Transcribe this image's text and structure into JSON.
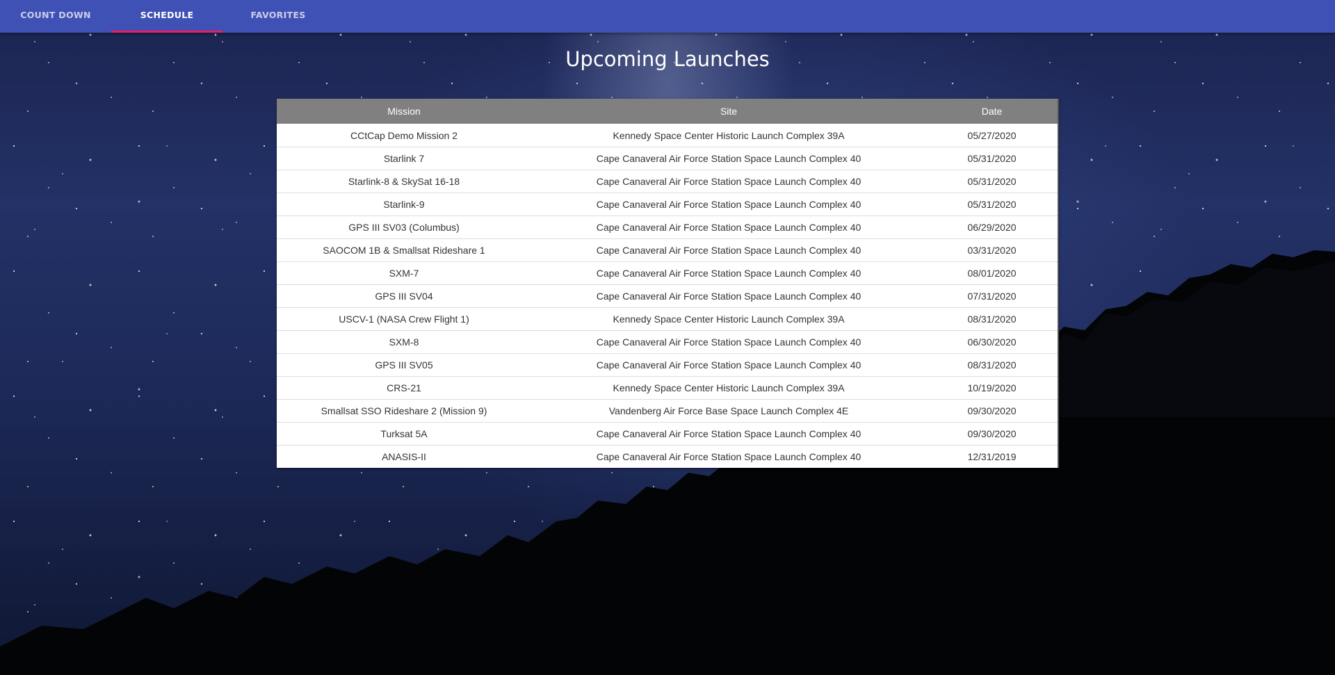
{
  "nav": {
    "tabs": [
      {
        "label": "COUNT DOWN",
        "active": false
      },
      {
        "label": "SCHEDULE",
        "active": true
      },
      {
        "label": "FAVORITES",
        "active": false
      }
    ],
    "bar_color": "#3f51b5",
    "indicator_color": "#e91e63"
  },
  "page": {
    "title": "Upcoming Launches"
  },
  "table": {
    "header_color": "#808080",
    "columns": [
      "Mission",
      "Site",
      "Date"
    ],
    "rows": [
      {
        "mission": "CCtCap Demo Mission 2",
        "site": "Kennedy Space Center Historic Launch Complex 39A",
        "date": "05/27/2020"
      },
      {
        "mission": "Starlink 7",
        "site": "Cape Canaveral Air Force Station Space Launch Complex 40",
        "date": "05/31/2020"
      },
      {
        "mission": "Starlink-8 & SkySat 16-18",
        "site": "Cape Canaveral Air Force Station Space Launch Complex 40",
        "date": "05/31/2020"
      },
      {
        "mission": "Starlink-9",
        "site": "Cape Canaveral Air Force Station Space Launch Complex 40",
        "date": "05/31/2020"
      },
      {
        "mission": "GPS III SV03 (Columbus)",
        "site": "Cape Canaveral Air Force Station Space Launch Complex 40",
        "date": "06/29/2020"
      },
      {
        "mission": "SAOCOM 1B & Smallsat Rideshare 1",
        "site": "Cape Canaveral Air Force Station Space Launch Complex 40",
        "date": "03/31/2020"
      },
      {
        "mission": "SXM-7",
        "site": "Cape Canaveral Air Force Station Space Launch Complex 40",
        "date": "08/01/2020"
      },
      {
        "mission": "GPS III SV04",
        "site": "Cape Canaveral Air Force Station Space Launch Complex 40",
        "date": "07/31/2020"
      },
      {
        "mission": "USCV-1 (NASA Crew Flight 1)",
        "site": "Kennedy Space Center Historic Launch Complex 39A",
        "date": "08/31/2020"
      },
      {
        "mission": "SXM-8",
        "site": "Cape Canaveral Air Force Station Space Launch Complex 40",
        "date": "06/30/2020"
      },
      {
        "mission": "GPS III SV05",
        "site": "Cape Canaveral Air Force Station Space Launch Complex 40",
        "date": "08/31/2020"
      },
      {
        "mission": "CRS-21",
        "site": "Kennedy Space Center Historic Launch Complex 39A",
        "date": "10/19/2020"
      },
      {
        "mission": "Smallsat SSO Rideshare 2 (Mission 9)",
        "site": "Vandenberg Air Force Base Space Launch Complex 4E",
        "date": "09/30/2020"
      },
      {
        "mission": "Turksat 5A",
        "site": "Cape Canaveral Air Force Station Space Launch Complex 40",
        "date": "09/30/2020"
      },
      {
        "mission": "ANASIS-II",
        "site": "Cape Canaveral Air Force Station Space Launch Complex 40",
        "date": "12/31/2019"
      }
    ]
  }
}
